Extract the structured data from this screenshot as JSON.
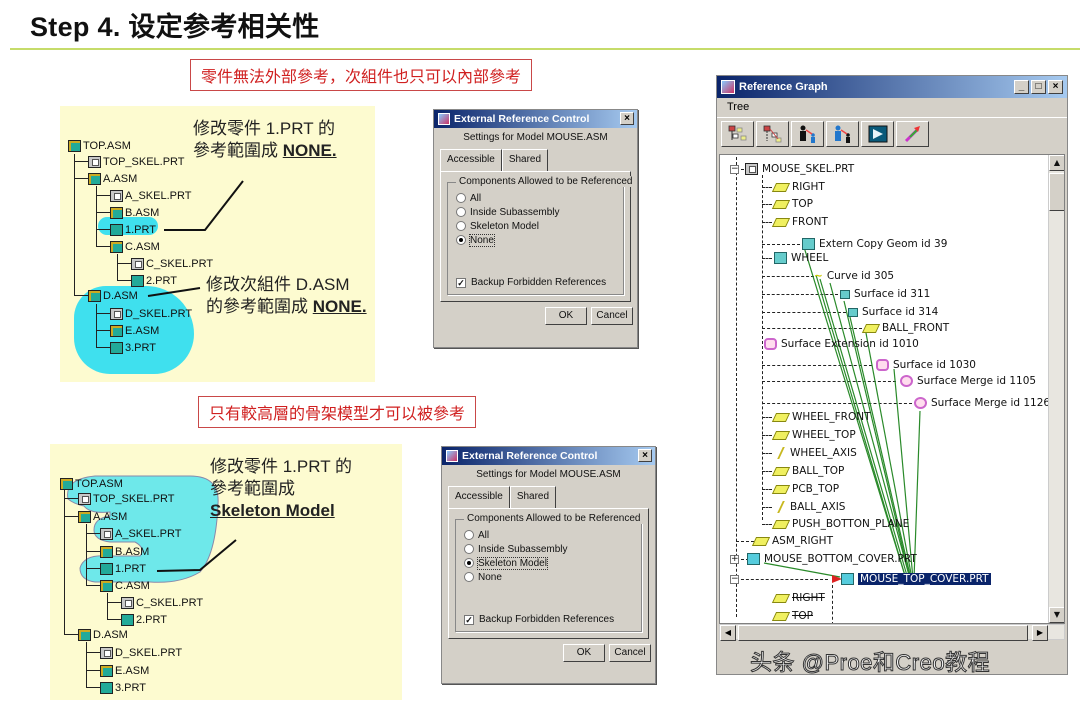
{
  "header": {
    "title": "Step 4. 设定参考相关性"
  },
  "section1": {
    "banner": "零件無法外部參考，次組件也只可以內部參考",
    "tree": [
      {
        "label": "TOP.ASM",
        "type": "asm"
      },
      {
        "label": "TOP_SKEL.PRT",
        "type": "skel"
      },
      {
        "label": "A.ASM",
        "type": "asm"
      },
      {
        "label": "A_SKEL.PRT",
        "type": "skel"
      },
      {
        "label": "B.ASM",
        "type": "asm"
      },
      {
        "label": "1.PRT",
        "type": "prt"
      },
      {
        "label": "C.ASM",
        "type": "asm"
      },
      {
        "label": "C_SKEL.PRT",
        "type": "skel"
      },
      {
        "label": "2.PRT",
        "type": "prt"
      },
      {
        "label": "D.ASM",
        "type": "asm"
      },
      {
        "label": "D_SKEL.PRT",
        "type": "skel"
      },
      {
        "label": "E.ASM",
        "type": "asm"
      },
      {
        "label": "3.PRT",
        "type": "prt"
      }
    ],
    "callout1": {
      "line1": "修改零件 1.PRT 的",
      "line2": "參考範圍成 ",
      "emph": "NONE."
    },
    "callout2": {
      "line1": "修改次組件 D.ASM",
      "line2": "的參考範圍成 ",
      "emph": "NONE."
    },
    "dialog": {
      "title": "External Reference Control",
      "subtitle": "Settings for Model MOUSE.ASM",
      "tabs": [
        "Accessible",
        "Shared"
      ],
      "active_tab": "Accessible",
      "group_label": "Components Allowed to be Referenced",
      "options": [
        "All",
        "Inside Subassembly",
        "Skeleton Model",
        "None"
      ],
      "selected": "None",
      "checkbox_label": "Backup Forbidden References",
      "checkbox_checked": true,
      "ok": "OK",
      "cancel": "Cancel"
    }
  },
  "section2": {
    "banner": "只有較高層的骨架模型才可以被參考",
    "callout": {
      "line1": "修改零件 1.PRT 的",
      "line2": "參考範圍成",
      "emph": "Skeleton Model"
    },
    "dialog": {
      "title": "External Reference Control",
      "subtitle": "Settings for Model MOUSE.ASM",
      "tabs": [
        "Accessible",
        "Shared"
      ],
      "active_tab": "Accessible",
      "group_label": "Components Allowed to be Referenced",
      "options": [
        "All",
        "Inside Subassembly",
        "Skeleton Model",
        "None"
      ],
      "selected": "Skeleton Model",
      "checkbox_label": "Backup Forbidden References",
      "checkbox_checked": true,
      "ok": "OK",
      "cancel": "Cancel"
    }
  },
  "reference_graph": {
    "title": "Reference Graph",
    "menu": [
      "Tree"
    ],
    "toolbar_icons": [
      "tree-view-icon",
      "dependency-view-icon",
      "parents-icon",
      "children-icon",
      "fit-view-icon",
      "highlight-arrow-icon"
    ],
    "nodes": [
      {
        "label": "MOUSE_SKEL.PRT",
        "icon": "skel"
      },
      {
        "label": "RIGHT",
        "icon": "plane"
      },
      {
        "label": "TOP",
        "icon": "plane"
      },
      {
        "label": "FRONT",
        "icon": "plane"
      },
      {
        "label": "Extern Copy Geom id 39",
        "icon": "feat"
      },
      {
        "label": "WHEEL",
        "icon": "feat"
      },
      {
        "label": "Curve id 305",
        "icon": "curve"
      },
      {
        "label": "Surface id 311",
        "icon": "feat"
      },
      {
        "label": "Surface id 314",
        "icon": "feat"
      },
      {
        "label": "BALL_FRONT",
        "icon": "plane"
      },
      {
        "label": "Surface Extension id 1010",
        "icon": "surf"
      },
      {
        "label": "Surface id 1030",
        "icon": "surf"
      },
      {
        "label": "Surface Merge id 1105",
        "icon": "surf"
      },
      {
        "label": "Surface Merge id 1126",
        "icon": "surf"
      },
      {
        "label": "WHEEL_FRONT",
        "icon": "plane"
      },
      {
        "label": "WHEEL_TOP",
        "icon": "plane"
      },
      {
        "label": "WHEEL_AXIS",
        "icon": "axis"
      },
      {
        "label": "BALL_TOP",
        "icon": "plane"
      },
      {
        "label": "PCB_TOP",
        "icon": "plane"
      },
      {
        "label": "BALL_AXIS",
        "icon": "axis"
      },
      {
        "label": "PUSH_BOTTON_PLANE",
        "icon": "plane"
      },
      {
        "label": "ASM_RIGHT",
        "icon": "plane"
      },
      {
        "label": "MOUSE_BOTTOM_COVER.PRT",
        "icon": "prt"
      },
      {
        "label": "MOUSE_TOP_COVER.PRT",
        "icon": "prt",
        "selected": true
      },
      {
        "label": "RIGHT",
        "icon": "plane"
      },
      {
        "label": "TOP",
        "icon": "plane"
      }
    ]
  },
  "watermark": "头条 @Proe和Creo教程",
  "colors": {
    "accent_rule": "#c6dc6a",
    "banner_red": "#d02020",
    "highlight_cyan": "#3fe0ee",
    "panel_yellow": "#fdfbd0",
    "selection_navy": "#0a246a",
    "ref_arrow_green": "#2a8a2a"
  }
}
